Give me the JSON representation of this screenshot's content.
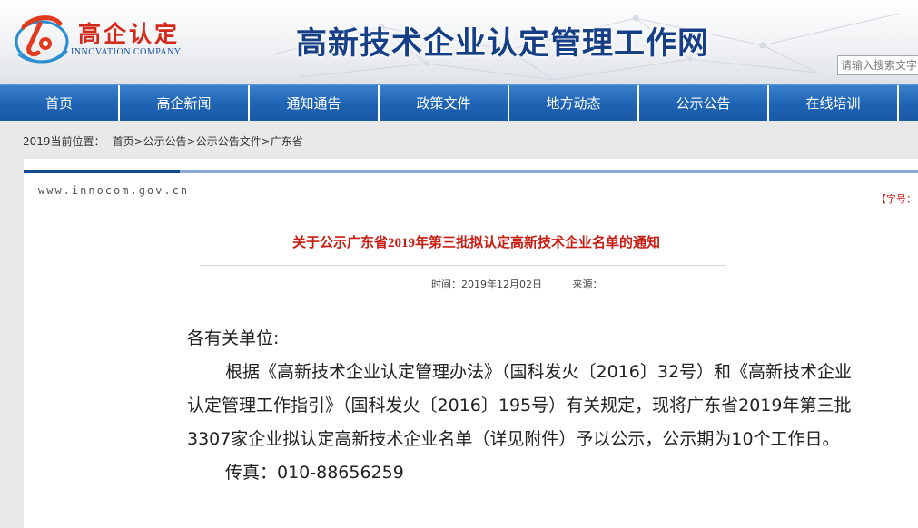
{
  "header": {
    "logo_text": "高企认定",
    "logo_sub": "INNOVATION COMPANY",
    "site_title": "高新技术企业认定管理工作网",
    "search_placeholder": "请输入搜索文字"
  },
  "nav": {
    "items": [
      "首页",
      "高企新闻",
      "通知通告",
      "政策文件",
      "地方动态",
      "公示公告",
      "在线培训"
    ]
  },
  "breadcrumb": {
    "year": "2019",
    "prefix": "当前位置：",
    "items": [
      "首页",
      "公示公告",
      "公示公告文件",
      "广东省"
    ],
    "separator": ">"
  },
  "panel": {
    "domain": "www.innocom.gov.cn",
    "font_size_label": "【字号："
  },
  "article": {
    "title": "关于公示广东省2019年第三批拟认定高新技术企业名单的通知",
    "time_label": "时间：2019年12月02日",
    "source_label": "来源：",
    "salutation": "各有关单位:",
    "paragraph": "根据《高新技术企业认定管理办法》（国科发火〔2016〕32号）和《高新技术企业认定管理工作指引》（国科发火〔2016〕195号）有关规定，现将广东省2019年第三批3307家企业拟认定高新技术企业名单（详见附件）予以公示，公示期为10个工作日。",
    "fax": "传真：010-88656259"
  },
  "colors": {
    "nav_blue": "#1e63b3",
    "title_blue": "#173f87",
    "title_red": "#c81d12",
    "logo_red": "#d42a1c"
  }
}
